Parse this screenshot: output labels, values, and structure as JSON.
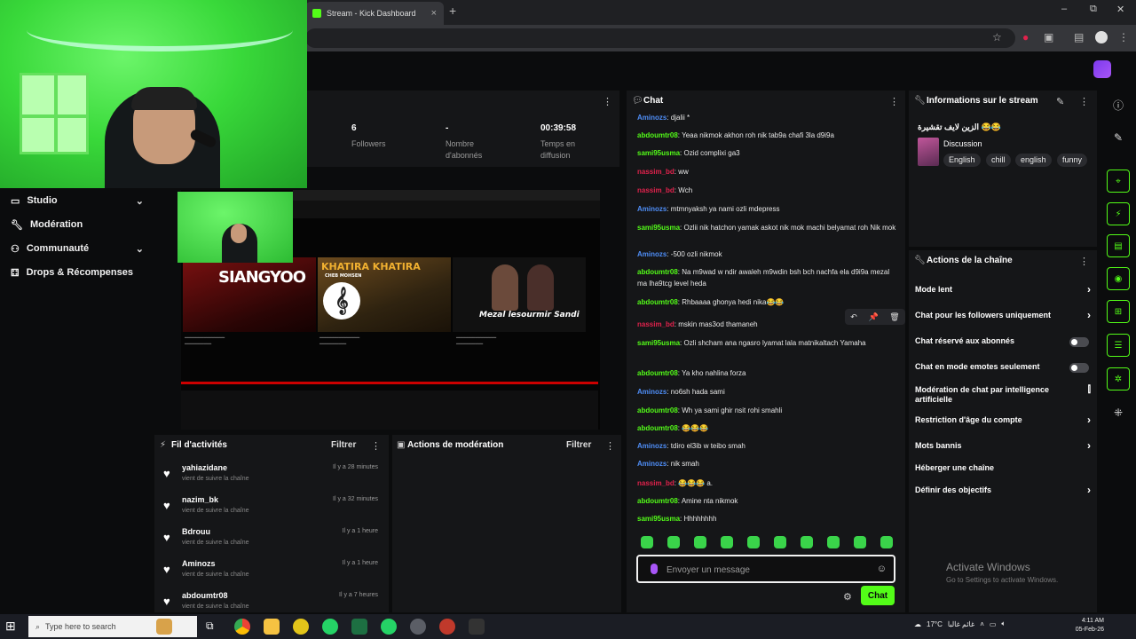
{
  "browser": {
    "tab_title": "Stream - Kick Dashboard",
    "tab_close": "×",
    "new_tab": "+",
    "window_controls": [
      "–",
      "⧉",
      "✕"
    ]
  },
  "sidebar": {
    "items": [
      {
        "label": "Studio",
        "icon": "studio-icon",
        "expandable": true
      },
      {
        "label": "Modération",
        "icon": "wrench-icon",
        "expandable": false
      },
      {
        "label": "Communauté",
        "icon": "community-icon",
        "expandable": true
      },
      {
        "label": "Drops & Récompenses",
        "icon": "gift-icon",
        "expandable": false
      }
    ]
  },
  "stats": {
    "followers_value": "6",
    "followers_label": "Followers",
    "subs_value": "-",
    "subs_label": "Nombre d'abonnés",
    "time_value": "00:39:58",
    "time_label": "Temps en diffusion"
  },
  "preview": {
    "thumb1": "SIANGYOO",
    "thumb2": "KHATIRA KHATIRA",
    "thumb2_sub": "CHEB MOHSEN",
    "thumb3": "Mezal lesourmir Sandi"
  },
  "activity": {
    "title": "Fil d'activités",
    "filter": "Filtrer",
    "items": [
      {
        "name": "yahiazidane",
        "sub": "vient de suivre la chaîne",
        "time": "Il y a 28 minutes"
      },
      {
        "name": "nazim_bk",
        "sub": "vient de suivre la chaîne",
        "time": "Il y a 32 minutes"
      },
      {
        "name": "Bdrouu",
        "sub": "vient de suivre la chaîne",
        "time": "Il y a 1 heure"
      },
      {
        "name": "Aminozs",
        "sub": "vient de suivre la chaîne",
        "time": "Il y a 1 heure"
      },
      {
        "name": "abdoumtr08",
        "sub": "vient de suivre la chaîne",
        "time": "Il y a 7 heures"
      }
    ]
  },
  "moderation": {
    "title": "Actions de modération",
    "filter": "Filtrer"
  },
  "chat": {
    "title": "Chat",
    "messages": [
      {
        "user": "Aminozs",
        "color": "blue",
        "text": "djalii *"
      },
      {
        "user": "abdoumtr08",
        "color": "green",
        "text": "Yeaa nikmok akhon roh nik tab9a chafi 3la d9i9a"
      },
      {
        "user": "sami95usma",
        "color": "green",
        "text": "Ozid complixi ga3"
      },
      {
        "user": "nassim_bd",
        "color": "red",
        "text": "ww"
      },
      {
        "user": "nassim_bd",
        "color": "red",
        "text": "Wch"
      },
      {
        "user": "Aminozs",
        "color": "blue",
        "text": "mtmnyaksh ya nami ozli mdepress"
      },
      {
        "user": "sami95usma",
        "color": "green",
        "text": "Ozlii nik hatchon yamak askot nik mok machi belyamat roh Nik mok"
      },
      {
        "user": "Aminozs",
        "color": "blue",
        "text": "-500 ozli nikmok"
      },
      {
        "user": "abdoumtr08",
        "color": "green",
        "text": "Na m9wad w ndir awaleh m9wdin bsh bch nachfa ela d9i9a mezal ma lha9tcg level heda"
      },
      {
        "user": "abdoumtr08",
        "color": "green",
        "text": "Rhbaaaa ghonya hedi nika😂😂"
      },
      {
        "user": "nassim_bd",
        "color": "red",
        "text": "mskin mas3od thamaneh"
      },
      {
        "user": "sami95usma",
        "color": "green",
        "text": "Ozli shcham ana ngasro lyamat lala matnikaltach Yamaha"
      },
      {
        "user": "abdoumtr08",
        "color": "green",
        "text": "Ya kho nahlina forza"
      },
      {
        "user": "Aminozs",
        "color": "blue",
        "text": "no6sh hada sami"
      },
      {
        "user": "abdoumtr08",
        "color": "green",
        "text": "Wh ya sami ghir nsit rohi smahli"
      },
      {
        "user": "abdoumtr08",
        "color": "green",
        "text": "😂😂😂"
      },
      {
        "user": "Aminozs",
        "color": "blue",
        "text": "tdiro el3ib w teibo smah"
      },
      {
        "user": "Aminozs",
        "color": "blue",
        "text": "nik smah"
      },
      {
        "user": "nassim_bd",
        "color": "red",
        "text": "😂😂😂 a."
      },
      {
        "user": "abdoumtr08",
        "color": "green",
        "text": "Amine nta nikmok"
      },
      {
        "user": "sami95usma",
        "color": "green",
        "text": "Hhhhhhhh"
      }
    ],
    "placeholder": "Envoyer un message",
    "send_label": "Chat",
    "hover_tools": [
      "↶",
      "📌",
      "🗑"
    ]
  },
  "stream_info": {
    "title": "Informations sur le stream",
    "stream_title": "الزين لايف تقشيرة 😂😂",
    "category": "Discussion",
    "tags": [
      "English",
      "chill",
      "english",
      "funny"
    ]
  },
  "channel_actions": {
    "title": "Actions de la chaîne",
    "items": [
      {
        "label": "Mode lent",
        "control": "arrow"
      },
      {
        "label": "Chat pour les followers uniquement",
        "control": "arrow"
      },
      {
        "label": "Chat réservé aux abonnés",
        "control": "toggle"
      },
      {
        "label": "Chat en mode emotes seulement",
        "control": "toggle"
      },
      {
        "label": "Modération de chat par intelligence artificielle",
        "control": "icon"
      },
      {
        "label": "Restriction d'âge du compte",
        "control": "arrow"
      },
      {
        "label": "Mots bannis",
        "control": "arrow"
      },
      {
        "label": "Héberger une chaîne",
        "control": "none"
      },
      {
        "label": "Définir des objectifs",
        "control": "arrow"
      }
    ]
  },
  "watermark": {
    "line1": "Activate Windows",
    "line2": "Go to Settings to activate Windows."
  },
  "taskbar": {
    "search_placeholder": "Type here to search",
    "weather": "17°C",
    "weather_label": "غائم غالبا",
    "time": "4:11 AM",
    "date": "05-Feb-26"
  },
  "colors": {
    "accent": "#53fc18",
    "panel": "#151618",
    "background": "#0b0c0d",
    "user_blue": "#4f8ef7",
    "user_red": "#e0224c"
  }
}
